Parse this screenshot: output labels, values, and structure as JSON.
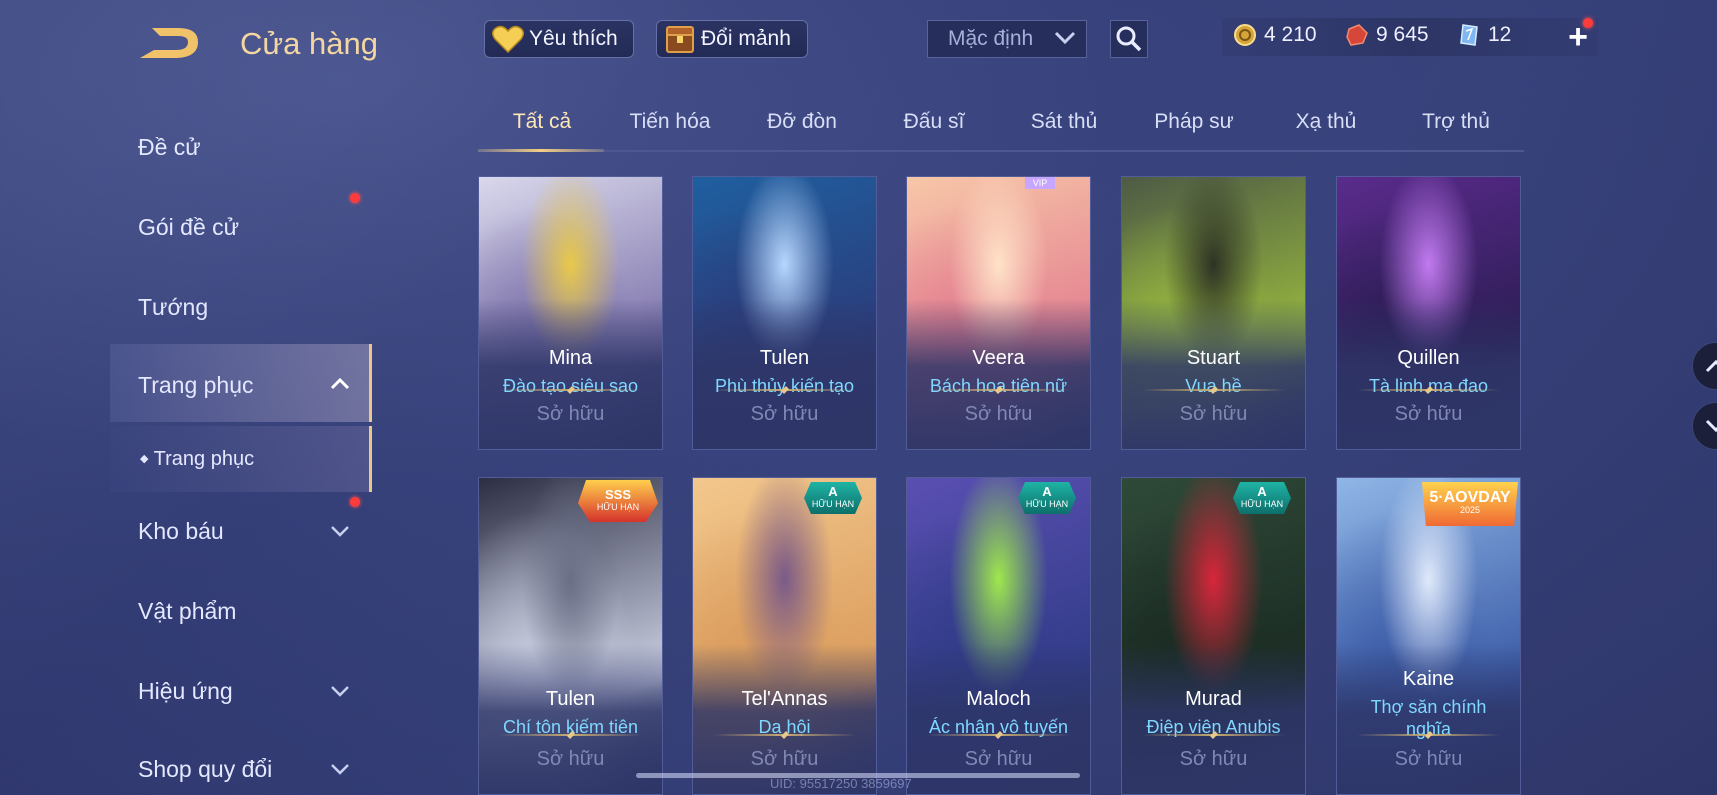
{
  "header": {
    "title": "Cửa hàng",
    "favorites_label": "Yêu thích",
    "shards_label": "Đổi mảnh",
    "sort_label": "Mặc định"
  },
  "currency": {
    "gold": "4 210",
    "vouchers": "9 645",
    "gems": "12"
  },
  "sidebar": {
    "items": [
      {
        "label": "Đề cử"
      },
      {
        "label": "Gói đề cử"
      },
      {
        "label": "Tướng"
      },
      {
        "label": "Trang phục"
      },
      {
        "label": "Trang phục"
      },
      {
        "label": "Kho báu"
      },
      {
        "label": "Vật phẩm"
      },
      {
        "label": "Hiệu ứng"
      },
      {
        "label": "Shop quy đổi"
      }
    ]
  },
  "tabs": [
    {
      "label": "Tất cả"
    },
    {
      "label": "Tiến hóa"
    },
    {
      "label": "Đỡ đòn"
    },
    {
      "label": "Đấu sĩ"
    },
    {
      "label": "Sát thủ"
    },
    {
      "label": "Pháp sư"
    },
    {
      "label": "Xạ thủ"
    },
    {
      "label": "Trợ thủ"
    }
  ],
  "cards": [
    {
      "hero": "Mina",
      "skin": "Đào tạo siêu sao",
      "status": "Sở hữu",
      "art_colors": [
        "#d9d8ec",
        "#7a6fa8",
        "#e8c84a"
      ]
    },
    {
      "hero": "Tulen",
      "skin": "Phù thủy kiến tạo",
      "status": "Sở hữu",
      "art_colors": [
        "#1f5fa0",
        "#2c3a78",
        "#b6d7ff"
      ]
    },
    {
      "hero": "Veera",
      "skin": "Bách hoa tiên nữ",
      "status": "Sở hữu",
      "vip": "VIP",
      "art_colors": [
        "#f7c7a8",
        "#e27a8e",
        "#ffe3c8"
      ]
    },
    {
      "hero": "Stuart",
      "skin": "Vua hề",
      "status": "Sở hữu",
      "art_colors": [
        "#4d5a45",
        "#9bbd3e",
        "#2e3324"
      ]
    },
    {
      "hero": "Quillen",
      "skin": "Tà linh ma đao",
      "status": "Sở hữu",
      "art_colors": [
        "#5a2b8c",
        "#2a1c52",
        "#c27af0"
      ]
    },
    {
      "hero": "Tulen",
      "skin": "Chí tôn kiếm tiên",
      "status": "Sở hữu",
      "badge": "SSS",
      "badge_sub": "HỮU HẠN",
      "art_colors": [
        "#2c2f44",
        "#cfd3e6",
        "#6b6f86"
      ]
    },
    {
      "hero": "Tel'Annas",
      "skin": "Dạ hội",
      "status": "Sở hữu",
      "badge": "A",
      "badge_sub": "HỮU HẠN",
      "art_colors": [
        "#f3c88d",
        "#d99a5b",
        "#7a5a88"
      ]
    },
    {
      "hero": "Maloch",
      "skin": "Ác nhân vô tuyến",
      "status": "Sở hữu",
      "badge": "A",
      "badge_sub": "HỮU HẠN",
      "art_colors": [
        "#5a4fb2",
        "#2f3b86",
        "#9fe84e"
      ]
    },
    {
      "hero": "Murad",
      "skin": "Điệp viên Anubis",
      "status": "Sở hữu",
      "badge": "A",
      "badge_sub": "HỮU HẠN",
      "art_colors": [
        "#2f4a38",
        "#1a2a22",
        "#d8263a"
      ]
    },
    {
      "hero": "Kaine",
      "skin": "Thợ săn chính nghĩa",
      "status": "Sở hữu",
      "badge": "5·AOVDAY",
      "badge_sub": "2025",
      "art_colors": [
        "#8fb6e6",
        "#3a5aa6",
        "#dfe9fb"
      ]
    }
  ],
  "footer": {
    "uid": "UID: 95517250 3859697"
  },
  "colors": {
    "accent_gold": "#f4d7a0",
    "skin_name": "#7fd8ff",
    "notify_red": "#ff3b3b"
  }
}
